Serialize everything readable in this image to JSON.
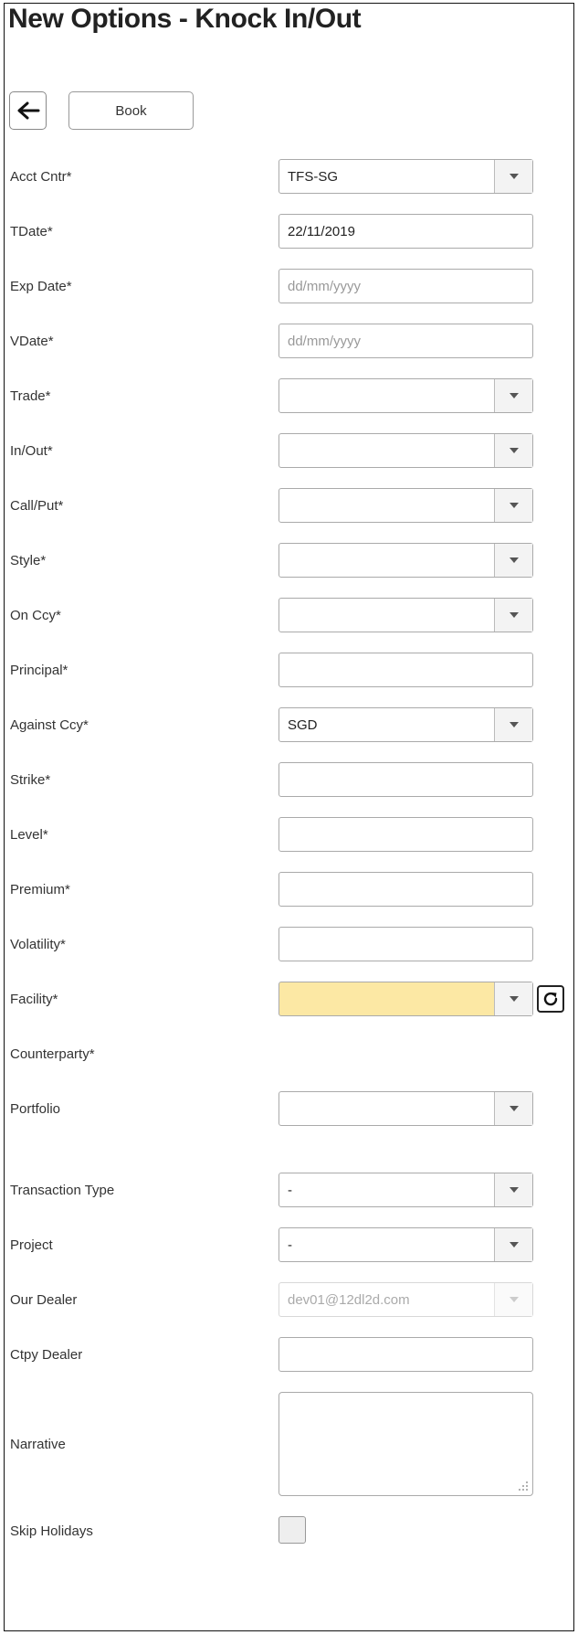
{
  "page": {
    "title": "New Options - Knock In/Out",
    "book_label": "Book"
  },
  "form": {
    "acct_cntr": {
      "label": "Acct Cntr*",
      "value": "TFS-SG"
    },
    "tdate": {
      "label": "TDate*",
      "value": "22/11/2019"
    },
    "exp_date": {
      "label": "Exp Date*",
      "placeholder": "dd/mm/yyyy"
    },
    "vdate": {
      "label": "VDate*",
      "placeholder": "dd/mm/yyyy"
    },
    "trade": {
      "label": "Trade*",
      "value": ""
    },
    "in_out": {
      "label": "In/Out*",
      "value": ""
    },
    "call_put": {
      "label": "Call/Put*",
      "value": ""
    },
    "style": {
      "label": "Style*",
      "value": ""
    },
    "on_ccy": {
      "label": "On Ccy*",
      "value": ""
    },
    "principal": {
      "label": "Principal*",
      "value": ""
    },
    "against_ccy": {
      "label": "Against Ccy*",
      "value": "SGD"
    },
    "strike": {
      "label": "Strike*",
      "value": ""
    },
    "level": {
      "label": "Level*",
      "value": ""
    },
    "premium": {
      "label": "Premium*",
      "value": ""
    },
    "volatility": {
      "label": "Volatility*",
      "value": ""
    },
    "facility": {
      "label": "Facility*",
      "value": "",
      "highlight_color": "#fce8a4"
    },
    "counterparty": {
      "label": "Counterparty*"
    },
    "portfolio": {
      "label": "Portfolio",
      "value": ""
    },
    "transaction_type": {
      "label": "Transaction Type",
      "value": "-"
    },
    "project": {
      "label": "Project",
      "value": "-"
    },
    "our_dealer": {
      "label": "Our Dealer",
      "value": "dev01@12dl2d.com",
      "disabled": true
    },
    "ctpy_dealer": {
      "label": "Ctpy Dealer",
      "value": ""
    },
    "narrative": {
      "label": "Narrative",
      "value": ""
    },
    "skip_holidays": {
      "label": "Skip Holidays",
      "checked": false
    }
  },
  "icons": {
    "back": "arrow-left-icon",
    "dropdown": "caret-down-icon",
    "refresh": "refresh-icon",
    "resize": "resize-grip-icon"
  }
}
